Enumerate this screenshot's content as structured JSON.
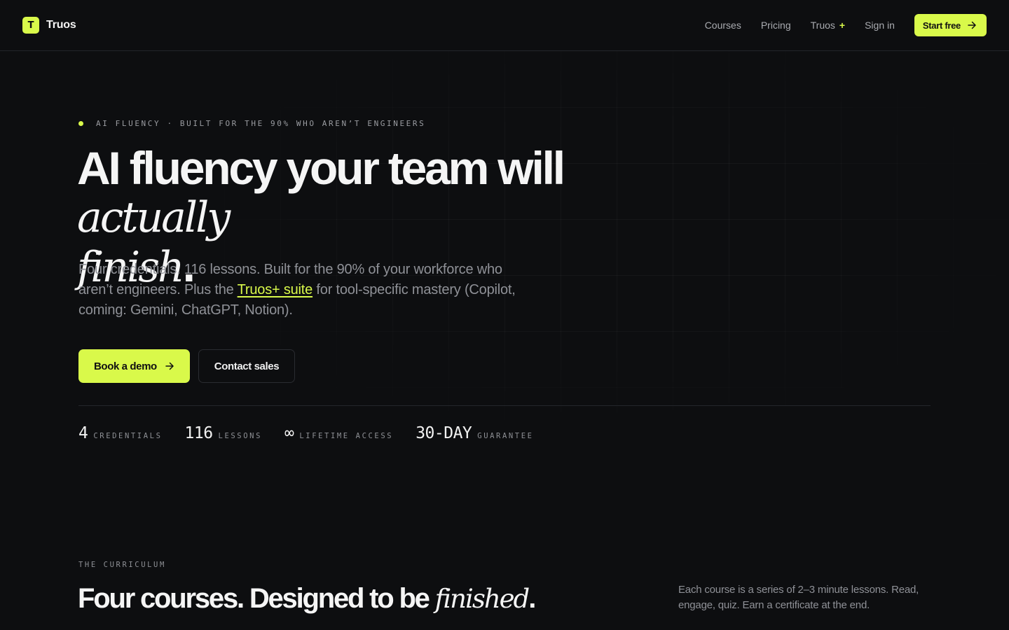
{
  "nav": {
    "brand_mark": "T",
    "brand_name": "Truos",
    "links": [
      "Courses",
      "Pricing",
      "Truos",
      "Sign in"
    ],
    "truos_plus_symbol": "+",
    "start_label": "Start free"
  },
  "hero": {
    "eyebrow": "AI FLUENCY · BUILT FOR THE 90% WHO AREN’T ENGINEERS",
    "title_main": "AI fluency your team will ",
    "title_italic_1": "actually",
    "title_italic_2": "finish",
    "title_period": ".",
    "sub_before": "Four credentials. 116 lessons. Built for the 90% of your workforce who aren’t engineers. Plus the ",
    "sub_link": "Truos+ suite",
    "sub_after": " for tool-specific mastery (Copilot, coming: Gemini, ChatGPT, Notion).",
    "demo_label": "Book a demo",
    "contact_label": "Contact sales"
  },
  "stats": [
    {
      "value": "4",
      "label": "CREDENTIALS"
    },
    {
      "value": "116",
      "label": "LESSONS"
    },
    {
      "value": "∞",
      "label": "LIFETIME ACCESS"
    },
    {
      "value": "30-DAY",
      "label": "GUARANTEE"
    }
  ],
  "curriculum": {
    "eyebrow": "THE CURRICULUM",
    "title_main": "Four courses. Designed to be ",
    "title_italic": "finished",
    "title_period": ".",
    "description": "Each course is a series of 2–3 minute lessons. Read, engage, quiz. Earn a certificate at the end."
  },
  "colors": {
    "background": "#0d0e10",
    "accent": "#d9f94a",
    "muted_text": "#8f9197"
  },
  "icons": [
    "arrow-right-icon",
    "status-dot-icon"
  ]
}
